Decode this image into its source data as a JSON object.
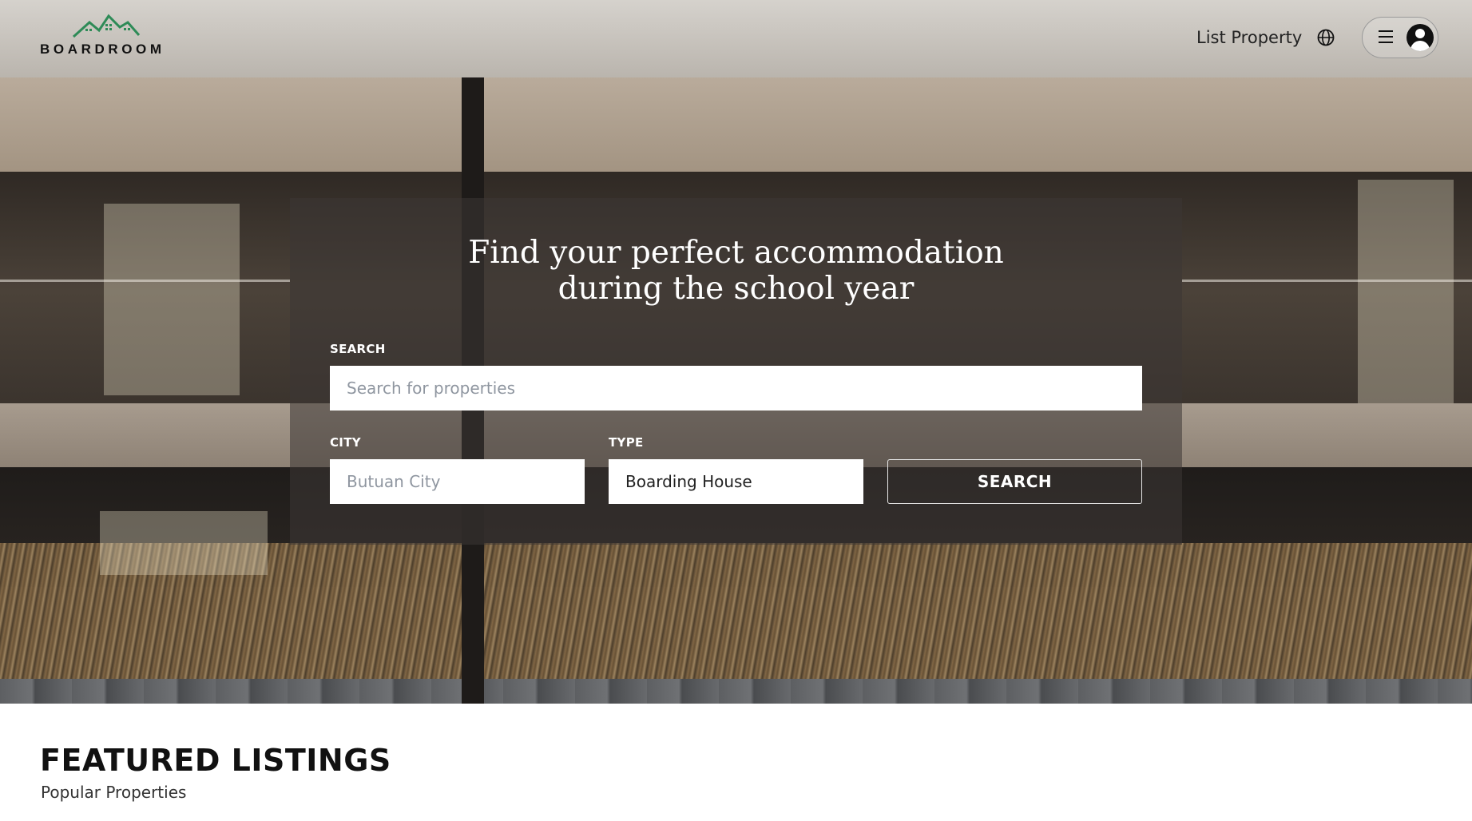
{
  "brand": {
    "name": "BOARDROOM",
    "accent": "#2e8b57"
  },
  "header": {
    "list_property": "List Property",
    "globe_icon": "globe-icon",
    "menu_icon": "hamburger-icon",
    "avatar_icon": "user-avatar-icon"
  },
  "hero": {
    "headline_line1": "Find your perfect accommodation",
    "headline_line2": "during the school year"
  },
  "search_form": {
    "search_label": "SEARCH",
    "search_placeholder": "Search for properties",
    "city_label": "CITY",
    "city_placeholder": "Butuan City",
    "type_label": "TYPE",
    "type_value": "Boarding House",
    "submit_label": "SEARCH"
  },
  "featured": {
    "title": "FEATURED LISTINGS",
    "subtitle": "Popular Properties"
  }
}
